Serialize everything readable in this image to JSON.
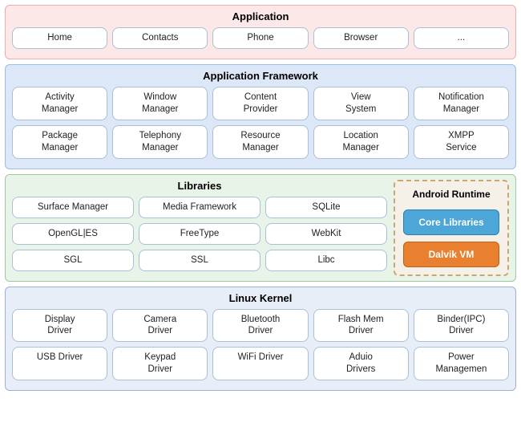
{
  "application": {
    "label": "Application",
    "buttons": [
      "Home",
      "Contacts",
      "Phone",
      "Browser",
      "..."
    ]
  },
  "framework": {
    "label": "Application Framework",
    "row1": [
      "Activity\nManager",
      "Window\nManager",
      "Content\nProvider",
      "View\nSystem",
      "Notification\nManager"
    ],
    "row2": [
      "Package\nManager",
      "Telephony\nManager",
      "Resource\nManager",
      "Location\nManager",
      "XMPP\nService"
    ]
  },
  "libraries": {
    "label": "Libraries",
    "row1": [
      "Surface Manager",
      "Media Framework",
      "SQLite"
    ],
    "row2": [
      "OpenGL|ES",
      "FreeType",
      "WebKit"
    ],
    "row3": [
      "SGL",
      "SSL",
      "Libc"
    ]
  },
  "androidRuntime": {
    "label": "Android Runtime",
    "coreLibraries": "Core Libraries",
    "dalvikVM": "Dalvik VM"
  },
  "kernel": {
    "label": "Linux Kernel",
    "row1": [
      "Display\nDriver",
      "Camera\nDriver",
      "Bluetooth\nDriver",
      "Flash Mem\nDriver",
      "Binder(IPC)\nDriver"
    ],
    "row2": [
      "USB Driver",
      "Keypad\nDriver",
      "WiFi Driver",
      "Aduio\nDrivers",
      "Power\nManagemen"
    ]
  }
}
